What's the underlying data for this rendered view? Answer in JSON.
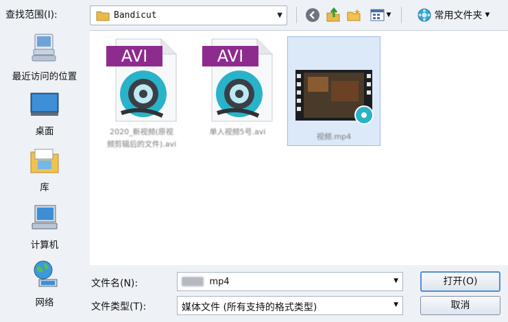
{
  "top_bar": {
    "lookin_label": "查找范围(I):",
    "current_folder": "Bandicut",
    "favorites_label": "常用文件夹",
    "icons": [
      "back-icon",
      "up-folder-icon",
      "new-folder-icon",
      "view-menu-icon",
      "favorites-icon"
    ]
  },
  "places": [
    {
      "label": "最近访问的位置",
      "icon": "recent-places-icon"
    },
    {
      "label": "桌面",
      "icon": "desktop-icon"
    },
    {
      "label": "库",
      "icon": "libraries-icon"
    },
    {
      "label": "计算机",
      "icon": "computer-icon"
    },
    {
      "label": "网络",
      "icon": "network-icon"
    }
  ],
  "files": [
    {
      "badge": "AVI",
      "name_line1": "2020_新视频(原视",
      "name_line2": "频剪辑后的文件).avi",
      "icon": "avi-file-icon"
    },
    {
      "badge": "AVI",
      "name_line1": "单人视频5号.avi",
      "name_line2": "",
      "icon": "avi-file-icon"
    },
    {
      "badge": "",
      "name_line1": "视频.mp4",
      "name_line2": "",
      "icon": "video-thumbnail-icon"
    }
  ],
  "form": {
    "filename_label": "文件名(N):",
    "filename_value": "mp4",
    "filetype_label": "文件类型(T):",
    "filetype_value": "媒体文件 (所有支持的格式类型)",
    "open_label": "打开(O)",
    "cancel_label": "取消"
  },
  "colors": {
    "accent": "#4f8fd1",
    "avi_badge": "#8e2b8e",
    "disc": "#29b3c9"
  }
}
